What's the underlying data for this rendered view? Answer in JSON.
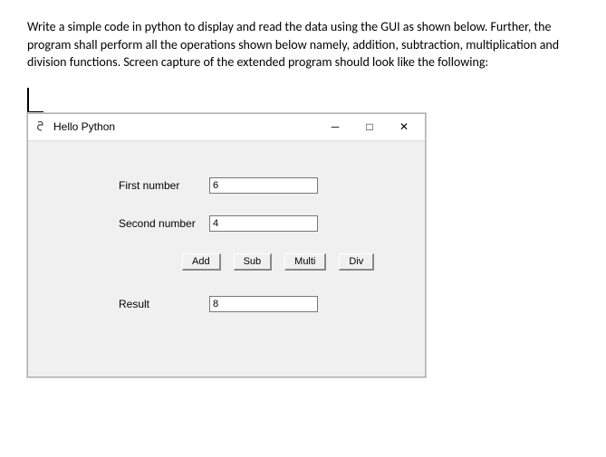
{
  "instruction": "Write a simple code in python to display and read the data using the GUI as shown below. Further, the program shall perform all the operations shown below namely, addition, subtraction, multiplication and division functions. Screen capture of the extended program should look like the following:",
  "window": {
    "title": "Hello Python",
    "controls": {
      "minimize": "─",
      "maximize": "□",
      "close": "✕"
    }
  },
  "form": {
    "first_label": "First number",
    "first_value": "6",
    "second_label": "Second number",
    "second_value": "4",
    "result_label": "Result",
    "result_value": "8"
  },
  "buttons": {
    "add": "Add",
    "sub": "Sub",
    "multi": "Multi",
    "div": "Div"
  }
}
